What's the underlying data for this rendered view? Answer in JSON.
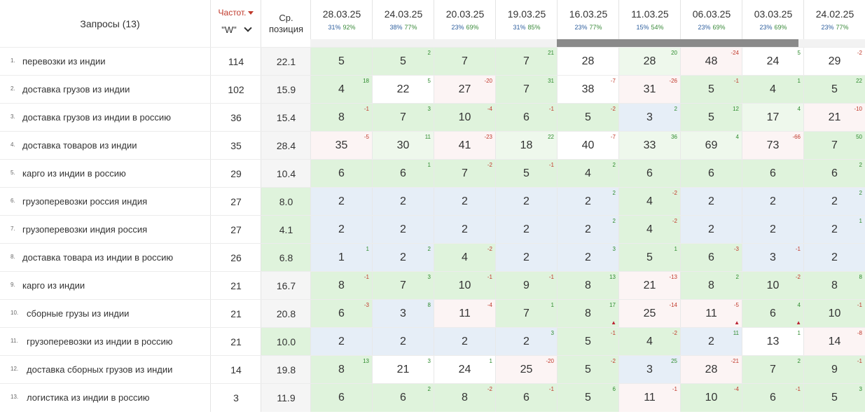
{
  "header": {
    "queries_label": "Запросы (13)",
    "freq_label": "Частот.",
    "freq_select_value": "\"W\"",
    "avg_label_1": "Ср.",
    "avg_label_2": "позиция"
  },
  "dates": [
    {
      "date": "28.03.25",
      "stat_a": "31%",
      "stat_b": "92%"
    },
    {
      "date": "24.03.25",
      "stat_a": "38%",
      "stat_b": "77%"
    },
    {
      "date": "20.03.25",
      "stat_a": "23%",
      "stat_b": "69%"
    },
    {
      "date": "19.03.25",
      "stat_a": "31%",
      "stat_b": "85%"
    },
    {
      "date": "16.03.25",
      "stat_a": "23%",
      "stat_b": "77%"
    },
    {
      "date": "11.03.25",
      "stat_a": "15%",
      "stat_b": "54%"
    },
    {
      "date": "06.03.25",
      "stat_a": "23%",
      "stat_b": "69%"
    },
    {
      "date": "03.03.25",
      "stat_a": "23%",
      "stat_b": "69%"
    },
    {
      "date": "24.02.25",
      "stat_a": "23%",
      "stat_b": "77%"
    }
  ],
  "colors": {
    "green": "#dff3dc",
    "light_green": "#eef8ec",
    "blue": "#e6eef7",
    "pink": "#fcf4f4",
    "white": "#ffffff",
    "avg_green": "#dff3dc",
    "avg_gray": "#f5f5f5"
  },
  "rows": [
    {
      "num": "1.",
      "query": "перевозки из индии",
      "freq": "114",
      "avg": "22.1",
      "avg_color": "gray",
      "positions": [
        {
          "v": "5",
          "d": "",
          "c": "green"
        },
        {
          "v": "5",
          "d": "2",
          "c": "green"
        },
        {
          "v": "7",
          "d": "",
          "c": "green"
        },
        {
          "v": "7",
          "d": "21",
          "c": "green"
        },
        {
          "v": "28",
          "d": "",
          "c": "white"
        },
        {
          "v": "28",
          "d": "20",
          "c": "light_green"
        },
        {
          "v": "48",
          "d": "-24",
          "c": "pink"
        },
        {
          "v": "24",
          "d": "5",
          "c": "white"
        },
        {
          "v": "29",
          "d": "-2",
          "c": "white"
        }
      ]
    },
    {
      "num": "2.",
      "query": "доставка грузов из индии",
      "freq": "102",
      "avg": "15.9",
      "avg_color": "gray",
      "positions": [
        {
          "v": "4",
          "d": "18",
          "c": "green"
        },
        {
          "v": "22",
          "d": "5",
          "c": "white"
        },
        {
          "v": "27",
          "d": "-20",
          "c": "pink"
        },
        {
          "v": "7",
          "d": "31",
          "c": "green"
        },
        {
          "v": "38",
          "d": "-7",
          "c": "white"
        },
        {
          "v": "31",
          "d": "-26",
          "c": "pink"
        },
        {
          "v": "5",
          "d": "-1",
          "c": "green"
        },
        {
          "v": "4",
          "d": "1",
          "c": "green"
        },
        {
          "v": "5",
          "d": "22",
          "c": "green"
        }
      ]
    },
    {
      "num": "3.",
      "query": "доставка грузов из индии в россию",
      "freq": "36",
      "avg": "15.4",
      "avg_color": "gray",
      "positions": [
        {
          "v": "8",
          "d": "-1",
          "c": "green"
        },
        {
          "v": "7",
          "d": "3",
          "c": "green"
        },
        {
          "v": "10",
          "d": "-4",
          "c": "green"
        },
        {
          "v": "6",
          "d": "-1",
          "c": "green"
        },
        {
          "v": "5",
          "d": "-2",
          "c": "green"
        },
        {
          "v": "3",
          "d": "2",
          "c": "blue"
        },
        {
          "v": "5",
          "d": "12",
          "c": "green"
        },
        {
          "v": "17",
          "d": "4",
          "c": "light_green"
        },
        {
          "v": "21",
          "d": "-10",
          "c": "pink"
        }
      ]
    },
    {
      "num": "4.",
      "query": "доставка товаров из индии",
      "freq": "35",
      "avg": "28.4",
      "avg_color": "gray",
      "positions": [
        {
          "v": "35",
          "d": "-5",
          "c": "pink"
        },
        {
          "v": "30",
          "d": "11",
          "c": "light_green"
        },
        {
          "v": "41",
          "d": "-23",
          "c": "pink"
        },
        {
          "v": "18",
          "d": "22",
          "c": "light_green"
        },
        {
          "v": "40",
          "d": "-7",
          "c": "white"
        },
        {
          "v": "33",
          "d": "36",
          "c": "light_green"
        },
        {
          "v": "69",
          "d": "4",
          "c": "light_green"
        },
        {
          "v": "73",
          "d": "-66",
          "c": "pink"
        },
        {
          "v": "7",
          "d": "50",
          "c": "green"
        }
      ]
    },
    {
      "num": "5.",
      "query": "карго из индии в россию",
      "freq": "29",
      "avg": "10.4",
      "avg_color": "gray",
      "positions": [
        {
          "v": "6",
          "d": "",
          "c": "green"
        },
        {
          "v": "6",
          "d": "1",
          "c": "green"
        },
        {
          "v": "7",
          "d": "-2",
          "c": "green"
        },
        {
          "v": "5",
          "d": "-1",
          "c": "green"
        },
        {
          "v": "4",
          "d": "2",
          "c": "green"
        },
        {
          "v": "6",
          "d": "",
          "c": "green"
        },
        {
          "v": "6",
          "d": "",
          "c": "green"
        },
        {
          "v": "6",
          "d": "",
          "c": "green"
        },
        {
          "v": "6",
          "d": "2",
          "c": "green"
        }
      ]
    },
    {
      "num": "6.",
      "query": "грузоперевозки россия индия",
      "freq": "27",
      "avg": "8.0",
      "avg_color": "green",
      "positions": [
        {
          "v": "2",
          "d": "",
          "c": "blue"
        },
        {
          "v": "2",
          "d": "",
          "c": "blue"
        },
        {
          "v": "2",
          "d": "",
          "c": "blue"
        },
        {
          "v": "2",
          "d": "",
          "c": "blue"
        },
        {
          "v": "2",
          "d": "2",
          "c": "blue"
        },
        {
          "v": "4",
          "d": "-2",
          "c": "green"
        },
        {
          "v": "2",
          "d": "",
          "c": "blue"
        },
        {
          "v": "2",
          "d": "",
          "c": "blue"
        },
        {
          "v": "2",
          "d": "2",
          "c": "blue"
        }
      ]
    },
    {
      "num": "7.",
      "query": "грузоперевозки индия россия",
      "freq": "27",
      "avg": "4.1",
      "avg_color": "green",
      "positions": [
        {
          "v": "2",
          "d": "",
          "c": "blue"
        },
        {
          "v": "2",
          "d": "",
          "c": "blue"
        },
        {
          "v": "2",
          "d": "",
          "c": "blue"
        },
        {
          "v": "2",
          "d": "",
          "c": "blue"
        },
        {
          "v": "2",
          "d": "2",
          "c": "blue"
        },
        {
          "v": "4",
          "d": "-2",
          "c": "green"
        },
        {
          "v": "2",
          "d": "",
          "c": "blue"
        },
        {
          "v": "2",
          "d": "",
          "c": "blue"
        },
        {
          "v": "2",
          "d": "1",
          "c": "blue"
        }
      ]
    },
    {
      "num": "8.",
      "query": "доставка товара из индии в россию",
      "freq": "26",
      "avg": "6.8",
      "avg_color": "green",
      "positions": [
        {
          "v": "1",
          "d": "1",
          "c": "blue"
        },
        {
          "v": "2",
          "d": "2",
          "c": "blue"
        },
        {
          "v": "4",
          "d": "-2",
          "c": "green"
        },
        {
          "v": "2",
          "d": "",
          "c": "blue"
        },
        {
          "v": "2",
          "d": "3",
          "c": "blue"
        },
        {
          "v": "5",
          "d": "1",
          "c": "green"
        },
        {
          "v": "6",
          "d": "-3",
          "c": "green"
        },
        {
          "v": "3",
          "d": "-1",
          "c": "blue"
        },
        {
          "v": "2",
          "d": "",
          "c": "blue"
        }
      ]
    },
    {
      "num": "9.",
      "query": "карго из индии",
      "freq": "21",
      "avg": "16.7",
      "avg_color": "gray",
      "positions": [
        {
          "v": "8",
          "d": "-1",
          "c": "green"
        },
        {
          "v": "7",
          "d": "3",
          "c": "green"
        },
        {
          "v": "10",
          "d": "-1",
          "c": "green"
        },
        {
          "v": "9",
          "d": "-1",
          "c": "green"
        },
        {
          "v": "8",
          "d": "13",
          "c": "green"
        },
        {
          "v": "21",
          "d": "-13",
          "c": "pink"
        },
        {
          "v": "8",
          "d": "2",
          "c": "green"
        },
        {
          "v": "10",
          "d": "-2",
          "c": "green"
        },
        {
          "v": "8",
          "d": "8",
          "c": "green"
        }
      ]
    },
    {
      "num": "10.",
      "query": "сборные грузы из индии",
      "freq": "21",
      "avg": "20.8",
      "avg_color": "gray",
      "positions": [
        {
          "v": "6",
          "d": "-3",
          "c": "green"
        },
        {
          "v": "3",
          "d": "8",
          "c": "blue"
        },
        {
          "v": "11",
          "d": "-4",
          "c": "pink"
        },
        {
          "v": "7",
          "d": "1",
          "c": "green"
        },
        {
          "v": "8",
          "d": "17",
          "c": "green",
          "w": true
        },
        {
          "v": "25",
          "d": "-14",
          "c": "pink"
        },
        {
          "v": "11",
          "d": "-5",
          "c": "pink",
          "w": true
        },
        {
          "v": "6",
          "d": "4",
          "c": "green",
          "w": true
        },
        {
          "v": "10",
          "d": "-1",
          "c": "green"
        }
      ]
    },
    {
      "num": "11.",
      "query": "грузоперевозки из индии в россию",
      "freq": "21",
      "avg": "10.0",
      "avg_color": "green",
      "positions": [
        {
          "v": "2",
          "d": "",
          "c": "blue"
        },
        {
          "v": "2",
          "d": "",
          "c": "blue"
        },
        {
          "v": "2",
          "d": "",
          "c": "blue"
        },
        {
          "v": "2",
          "d": "3",
          "c": "blue"
        },
        {
          "v": "5",
          "d": "-1",
          "c": "green"
        },
        {
          "v": "4",
          "d": "-2",
          "c": "green"
        },
        {
          "v": "2",
          "d": "11",
          "c": "blue"
        },
        {
          "v": "13",
          "d": "1",
          "c": "white"
        },
        {
          "v": "14",
          "d": "-8",
          "c": "pink"
        }
      ]
    },
    {
      "num": "12.",
      "query": "доставка сборных грузов из индии",
      "freq": "14",
      "avg": "19.8",
      "avg_color": "gray",
      "positions": [
        {
          "v": "8",
          "d": "13",
          "c": "green"
        },
        {
          "v": "21",
          "d": "3",
          "c": "white"
        },
        {
          "v": "24",
          "d": "1",
          "c": "white"
        },
        {
          "v": "25",
          "d": "-20",
          "c": "pink"
        },
        {
          "v": "5",
          "d": "-2",
          "c": "green"
        },
        {
          "v": "3",
          "d": "25",
          "c": "blue"
        },
        {
          "v": "28",
          "d": "-21",
          "c": "pink"
        },
        {
          "v": "7",
          "d": "2",
          "c": "green"
        },
        {
          "v": "9",
          "d": "-1",
          "c": "green"
        }
      ]
    },
    {
      "num": "13.",
      "query": "логистика из индии в россию",
      "freq": "3",
      "avg": "11.9",
      "avg_color": "gray",
      "positions": [
        {
          "v": "6",
          "d": "",
          "c": "green"
        },
        {
          "v": "6",
          "d": "2",
          "c": "green"
        },
        {
          "v": "8",
          "d": "-2",
          "c": "green"
        },
        {
          "v": "6",
          "d": "-1",
          "c": "green"
        },
        {
          "v": "5",
          "d": "6",
          "c": "green"
        },
        {
          "v": "11",
          "d": "-1",
          "c": "pink"
        },
        {
          "v": "10",
          "d": "-4",
          "c": "green"
        },
        {
          "v": "6",
          "d": "-1",
          "c": "green"
        },
        {
          "v": "5",
          "d": "3",
          "c": "green"
        }
      ]
    }
  ]
}
